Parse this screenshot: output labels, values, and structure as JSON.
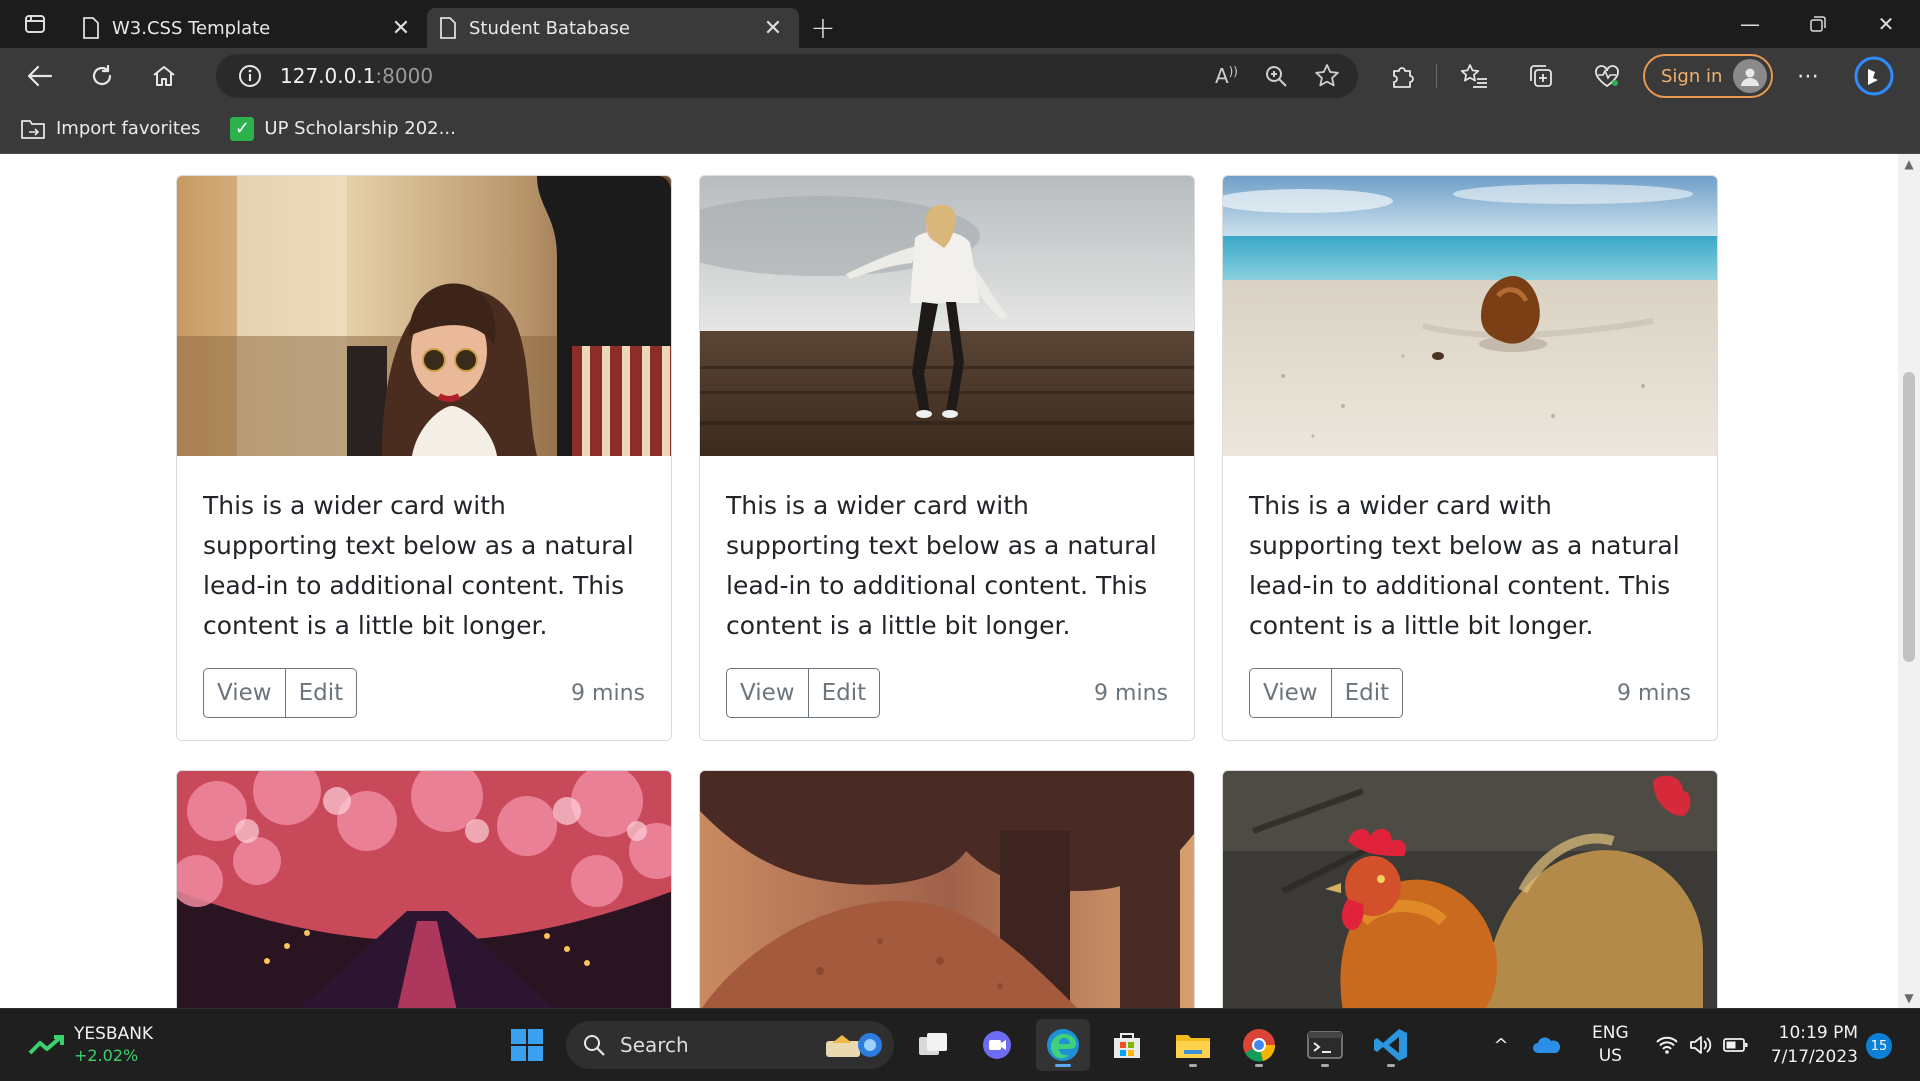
{
  "browser": {
    "tabs": [
      {
        "title": "W3.CSS Template",
        "active": false
      },
      {
        "title": "Student Batabase",
        "active": true
      }
    ],
    "address": {
      "host": "127.0.0.1",
      "port": ":8000"
    },
    "sign_in_label": "Sign in",
    "favorites": [
      {
        "label": "Import favorites",
        "icon": "import-favorites-icon"
      },
      {
        "label": "UP Scholarship 202...",
        "icon": "green-check-icon"
      }
    ]
  },
  "cards": [
    {
      "image": "woman-sunglasses-photo",
      "text": "This is a wider card with supporting text below as a natural lead-in to additional content. This content is a little bit longer.",
      "view_label": "View",
      "edit_label": "Edit",
      "time": "9 mins"
    },
    {
      "image": "woman-field-photo",
      "text": "This is a wider card with supporting text below as a natural lead-in to additional content. This content is a little bit longer.",
      "view_label": "View",
      "edit_label": "Edit",
      "time": "9 mins"
    },
    {
      "image": "beach-coconut-photo",
      "text": "This is a wider card with supporting text below as a natural lead-in to additional content. This content is a little bit longer.",
      "view_label": "View",
      "edit_label": "Edit",
      "time": "9 mins"
    }
  ],
  "cards_row2": [
    {
      "image": "cherry-blossom-canal-photo"
    },
    {
      "image": "elephant-dirt-photo"
    },
    {
      "image": "roosters-photo"
    }
  ],
  "taskbar": {
    "stock_name": "YESBANK",
    "stock_change": "+2.02%",
    "search_label": "Search",
    "lang_top": "ENG",
    "lang_bottom": "US",
    "time": "10:19 PM",
    "date": "7/17/2023",
    "notification_count": "15"
  },
  "colors": {
    "signin_accent": "#e59a4f",
    "stock_up": "#3bd16f",
    "outline_button": "#6c757d"
  }
}
